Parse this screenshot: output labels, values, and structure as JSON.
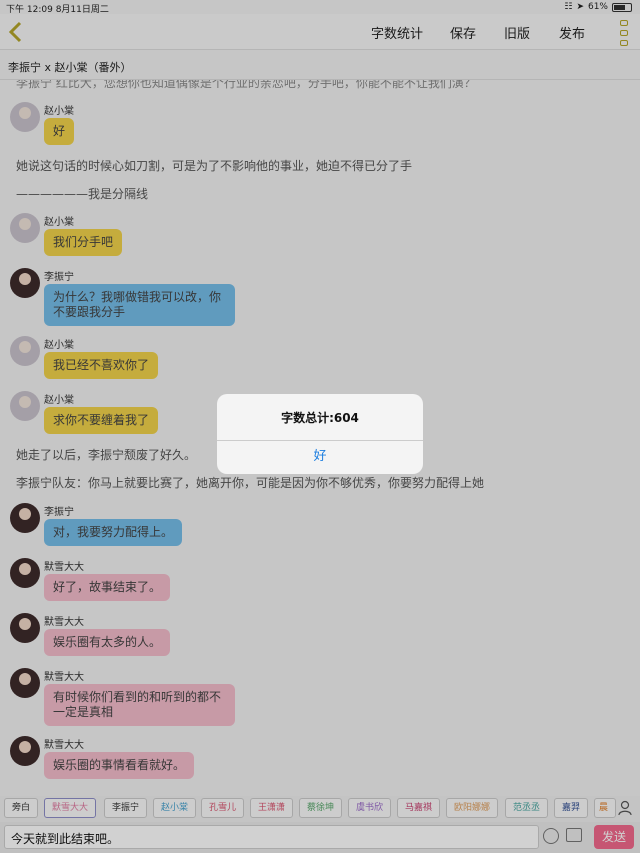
{
  "status": {
    "time": "下午 12:09",
    "date": "8月11日周二",
    "battery": "61%"
  },
  "nav": {
    "word_count": "字数统计",
    "save": "保存",
    "old_version": "旧版",
    "publish": "发布"
  },
  "title": "李振宁 x 赵小棠（番外）",
  "top_cut_text": "李振宁 红比大，您想你也知道偶像是个行业的亲恋吧，分手吧，你能不能不让我们演？",
  "messages": [
    {
      "type": "bubble",
      "sender": "赵小棠",
      "text": "好",
      "color": "yellow"
    },
    {
      "type": "narration",
      "text": "她说这句话的时候心如刀割，可是为了不影响他的事业，她迫不得已分了手"
    },
    {
      "type": "narration",
      "text": "——————我是分隔线"
    },
    {
      "type": "bubble",
      "sender": "赵小棠",
      "text": "我们分手吧",
      "color": "yellow"
    },
    {
      "type": "bubble",
      "sender": "李振宁",
      "text": "为什么？我哪做错我可以改，你不要跟我分手",
      "color": "blue"
    },
    {
      "type": "bubble",
      "sender": "赵小棠",
      "text": "我已经不喜欢你了",
      "color": "yellow"
    },
    {
      "type": "bubble",
      "sender": "赵小棠",
      "text": "求你不要缠着我了",
      "color": "yellow"
    },
    {
      "type": "narration",
      "text": "她走了以后，李振宁颓废了好久。"
    },
    {
      "type": "narration",
      "text": "李振宁队友：你马上就要比赛了，她离开你，可能是因为你不够优秀，你要努力配得上她"
    },
    {
      "type": "bubble",
      "sender": "李振宁",
      "text": "对，我要努力配得上。",
      "color": "blue"
    },
    {
      "type": "bubble",
      "sender": "默雪大大",
      "text": "好了，故事结束了。",
      "color": "pink"
    },
    {
      "type": "bubble",
      "sender": "默雪大大",
      "text": "娱乐圈有太多的人。",
      "color": "pink"
    },
    {
      "type": "bubble",
      "sender": "默雪大大",
      "text": "有时候你们看到的和听到的都不一定是真相",
      "color": "pink"
    },
    {
      "type": "bubble",
      "sender": "默雪大大",
      "text": "娱乐圈的事情看看就好。",
      "color": "pink"
    }
  ],
  "dialog": {
    "title": "字数总计:604",
    "ok": "好"
  },
  "roles": [
    "旁白",
    "默雪大大",
    "李振宁",
    "赵小棠",
    "孔雪儿",
    "王潇潇",
    "蔡徐坤",
    "虞书欣",
    "马嘉祺",
    "欧阳娜娜",
    "范丞丞",
    "嘉羿",
    "晨"
  ],
  "role_colors": [
    "#333333",
    "#e07aa0",
    "#333333",
    "#4aa3cf",
    "#d9546e",
    "#d9546e",
    "#5aa86d",
    "#9a6bc9",
    "#c94070",
    "#e0a060",
    "#46a6a0",
    "#2a4a90",
    "#e07a20"
  ],
  "input": {
    "value": "今天就到此结束吧。"
  },
  "send_label": "发送",
  "colors": {
    "yellow": "#f1d24b",
    "blue": "#76bde8",
    "pink": "#f3bccb",
    "send": "#f26a8d",
    "dialog_ok": "#1e7fe0"
  }
}
